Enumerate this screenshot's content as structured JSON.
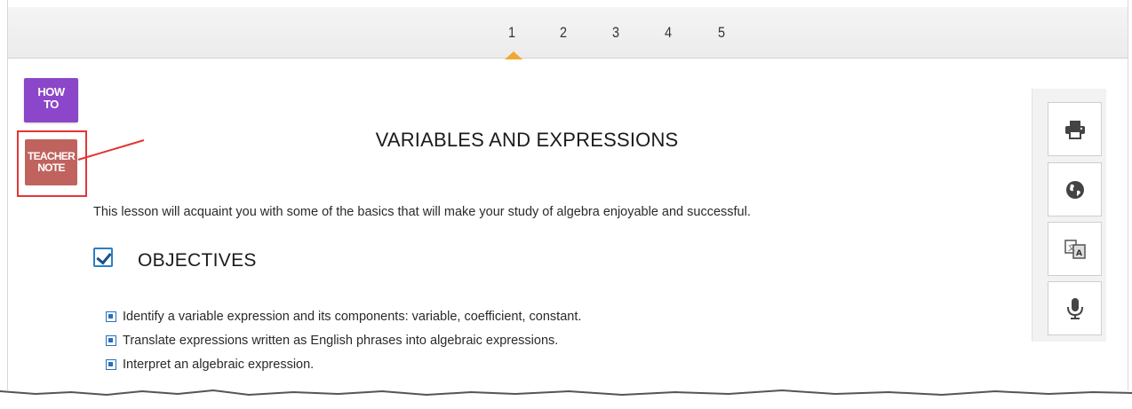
{
  "pager": {
    "pages": [
      "1",
      "2",
      "3",
      "4",
      "5"
    ],
    "active": "1",
    "accent_color": "#f0a830"
  },
  "side_buttons": {
    "how_to": {
      "line1": "HOW",
      "line2": "TO",
      "color": "#8b46c9"
    },
    "teacher_note": {
      "line1": "TEACHER",
      "line2": "NOTE",
      "color": "#c0635e"
    },
    "highlight_color": "#e33535"
  },
  "lesson": {
    "title": "VARIABLES AND EXPRESSIONS",
    "intro": "This lesson will acquaint you with some of the basics that will make your study of algebra enjoyable and successful.",
    "objectives_heading": "OBJECTIVES",
    "objectives": [
      "Identify a variable expression and its components: variable, coefficient, constant.",
      "Translate expressions written as English phrases into algebraic expressions.",
      "Interpret an algebraic expression."
    ]
  },
  "toolbar": {
    "icons": [
      "print-icon",
      "globe-icon",
      "translate-icon",
      "microphone-icon"
    ]
  }
}
